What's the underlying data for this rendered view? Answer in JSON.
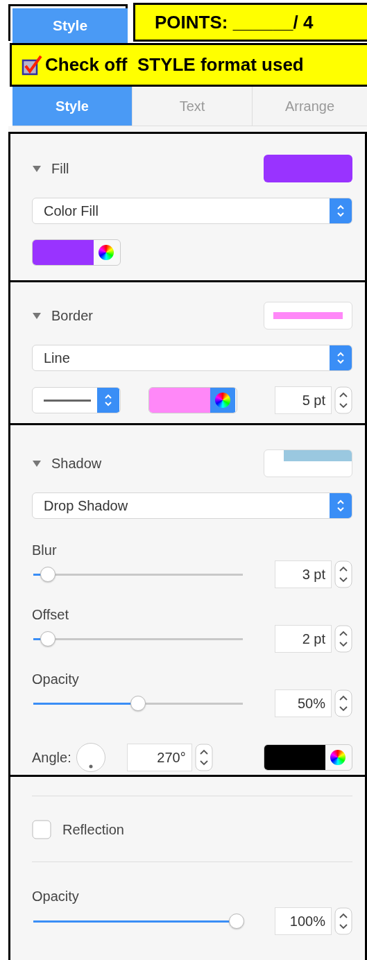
{
  "top_tab": {
    "label": "Style",
    "selected": true
  },
  "points": {
    "text": "POINTS: ______/ 4"
  },
  "checkoff": {
    "checked": true,
    "label": "Check off  STYLE format used"
  },
  "tabs": [
    {
      "label": "Style",
      "selected": true
    },
    {
      "label": "Text",
      "selected": false
    },
    {
      "label": "Arrange",
      "selected": false
    }
  ],
  "fill": {
    "title": "Fill",
    "expanded": true,
    "color": "#9933ff",
    "dropdown": "Color Fill"
  },
  "border": {
    "title": "Border",
    "expanded": true,
    "color": "#ff88f8",
    "dropdown": "Line",
    "size": "5 pt"
  },
  "shadow": {
    "title": "Shadow",
    "expanded": true,
    "dropdown": "Drop Shadow",
    "sliders": [
      {
        "label": "Blur",
        "level": 0.07,
        "value": "3 pt"
      },
      {
        "label": "Offset",
        "level": 0.07,
        "value": "2 pt"
      },
      {
        "label": "Opacity",
        "level": 0.5,
        "value": "50%"
      }
    ],
    "angle_label": "Angle:",
    "angle": "270°",
    "color": "#000000"
  },
  "reflection": {
    "checked": false,
    "label": "Reflection",
    "opacity_label": "Opacity",
    "opacity": {
      "level": 0.97,
      "value": "100%"
    }
  }
}
